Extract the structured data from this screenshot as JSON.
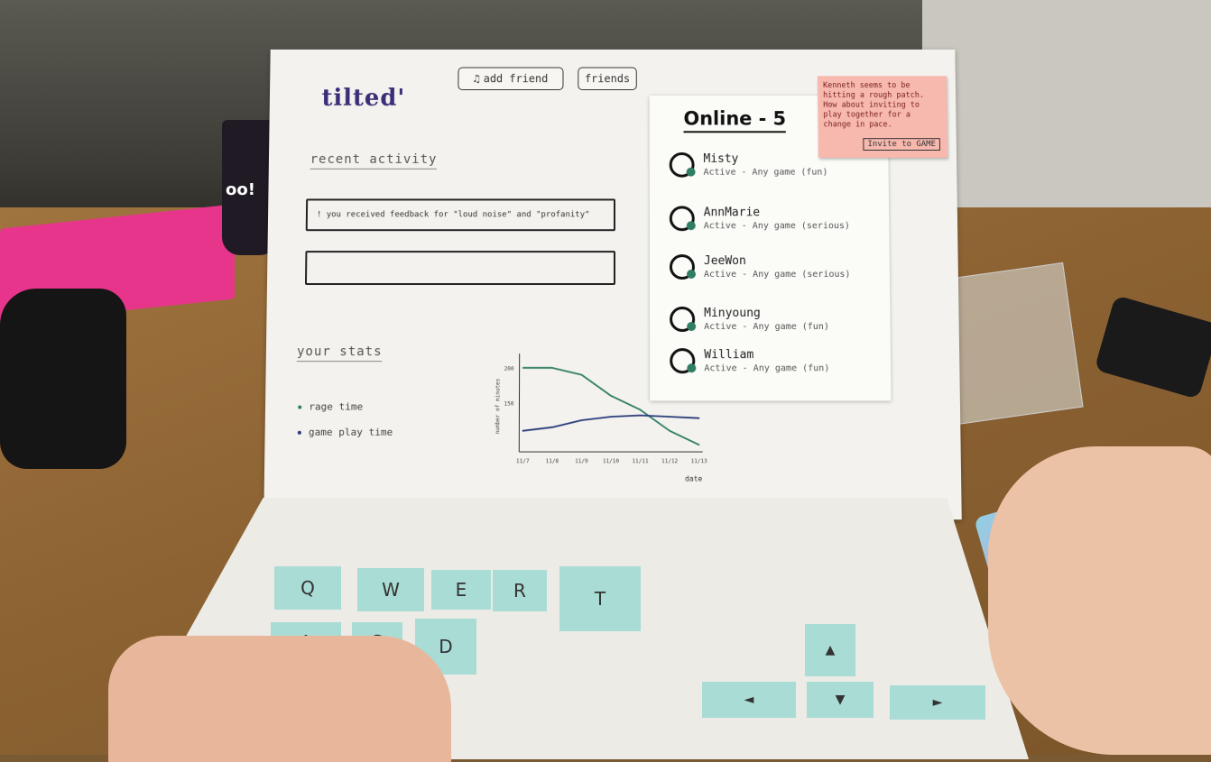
{
  "header": {
    "logo": "tilted'",
    "add_friend_label": "add friend",
    "friends_label": "friends"
  },
  "recent_activity": {
    "title": "recent activity",
    "items": [
      "! you received feedback for \"loud noise\" and \"profanity\"",
      ""
    ]
  },
  "stats": {
    "title": "your stats",
    "legend": [
      {
        "label": "rage time",
        "color": "#2f7d62"
      },
      {
        "label": "game play time",
        "color": "#283a7a"
      }
    ]
  },
  "chart_data": {
    "type": "line",
    "title": "",
    "xlabel": "date",
    "ylabel": "number of minutes",
    "categories": [
      "11/7",
      "11/8",
      "11/9",
      "11/10",
      "11/11",
      "11/12",
      "11/13"
    ],
    "ylim": [
      0,
      200
    ],
    "yticks": [
      "200",
      "150"
    ],
    "series": [
      {
        "name": "rage time",
        "color": "#2f7d62",
        "values": [
          200,
          200,
          190,
          160,
          140,
          110,
          90
        ]
      },
      {
        "name": "game play time",
        "color": "#283a7a",
        "values": [
          110,
          115,
          125,
          130,
          132,
          130,
          128
        ]
      }
    ]
  },
  "online": {
    "title": "Online - 5",
    "friends": [
      {
        "name": "Misty",
        "status": "Active - Any game (fun)"
      },
      {
        "name": "AnnMarie",
        "status": "Active - Any game (serious)"
      },
      {
        "name": "JeeWon",
        "status": "Active - Any game (serious)"
      },
      {
        "name": "Minyoung",
        "status": "Active - Any game (fun)"
      },
      {
        "name": "William",
        "status": "Active - Any game (fun)"
      }
    ]
  },
  "notification": {
    "message": "Kenneth seems to be hitting a rough patch. How about inviting to play together for a change in pace.",
    "invite_label": "Invite to GAME"
  },
  "keyboard": {
    "keys": [
      "Q",
      "W",
      "E",
      "R",
      "T",
      "A",
      "S",
      "D"
    ],
    "arrows": {
      "up": "▲",
      "left": "◄",
      "down": "▼",
      "right": "►"
    }
  },
  "colors": {
    "logo": "#3d2d78",
    "key": "#a9dcd4",
    "sticky": "#f7b8ae",
    "online_dot": "#2f7d62"
  }
}
